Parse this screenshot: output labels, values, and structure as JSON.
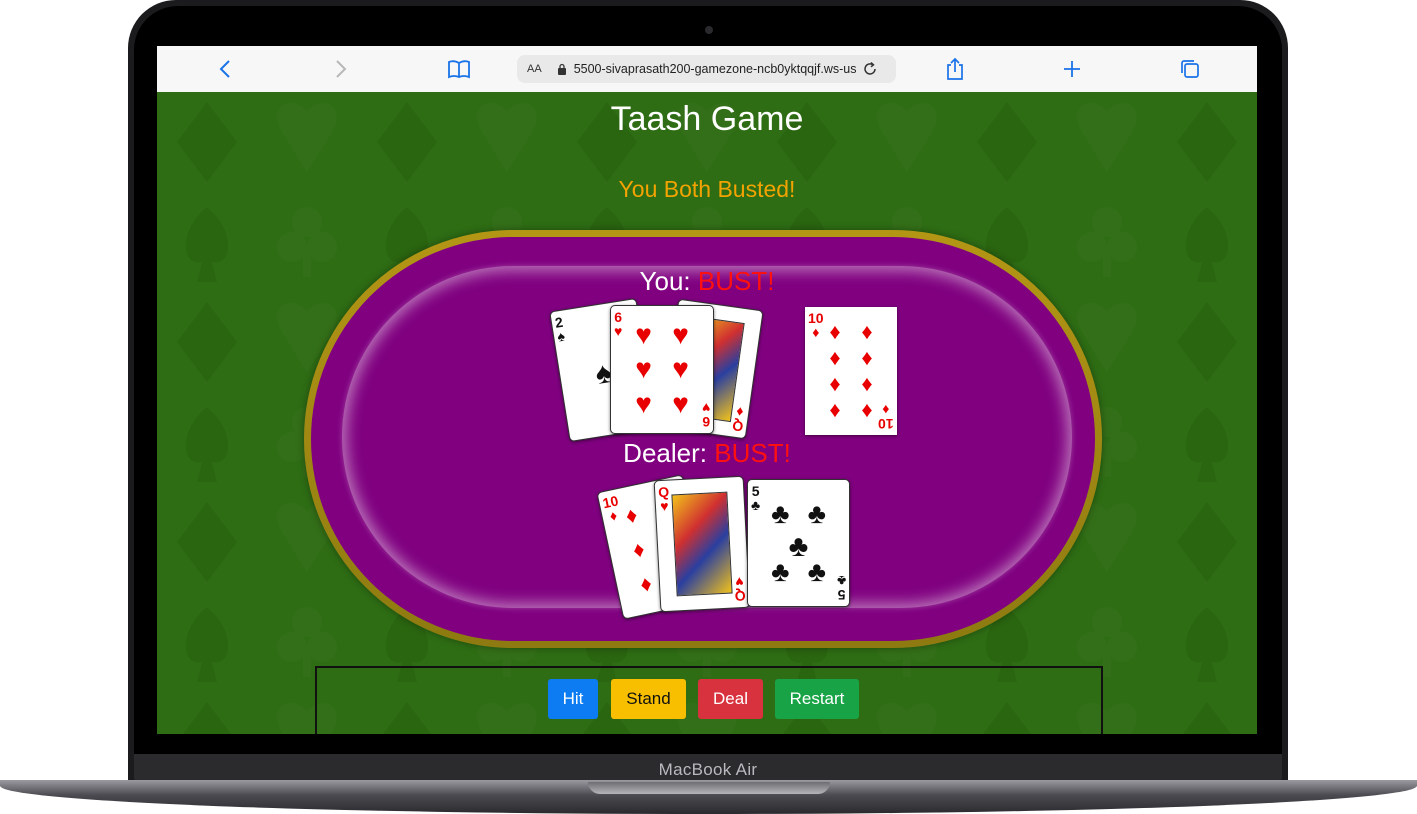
{
  "device": {
    "label": "MacBook Air"
  },
  "browser": {
    "text_size_label": "AA",
    "url": "5500-sivaprasath200-gamezone-ncb0yktqqjf.ws-us",
    "icons": [
      "back-icon",
      "forward-icon",
      "bookmarks-icon",
      "lock-icon",
      "reload-icon",
      "share-icon",
      "new-tab-icon",
      "tabs-icon"
    ]
  },
  "game": {
    "title": "Taash Game",
    "result": "You Both Busted!",
    "player": {
      "label": "You:",
      "score": "BUST!",
      "cards": [
        {
          "rank": "2",
          "suit": "♠",
          "color": "black"
        },
        {
          "rank": "6",
          "suit": "♥",
          "color": "red"
        },
        {
          "rank": "Q",
          "suit": "♦",
          "color": "red"
        },
        {
          "rank": "10",
          "suit": "♦",
          "color": "red"
        }
      ]
    },
    "dealer": {
      "label": "Dealer:",
      "score": "BUST!",
      "cards": [
        {
          "rank": "10",
          "suit": "♦",
          "color": "red"
        },
        {
          "rank": "Q",
          "suit": "♥",
          "color": "red"
        },
        {
          "rank": "5",
          "suit": "♣",
          "color": "black"
        }
      ]
    },
    "buttons": {
      "hit": "Hit",
      "stand": "Stand",
      "deal": "Deal",
      "restart": "Restart"
    },
    "colors": {
      "felt": "#2e6d14",
      "table": "#800080",
      "rim": "#b49615",
      "result": "#f3a300",
      "bust": "#ff1010"
    }
  }
}
